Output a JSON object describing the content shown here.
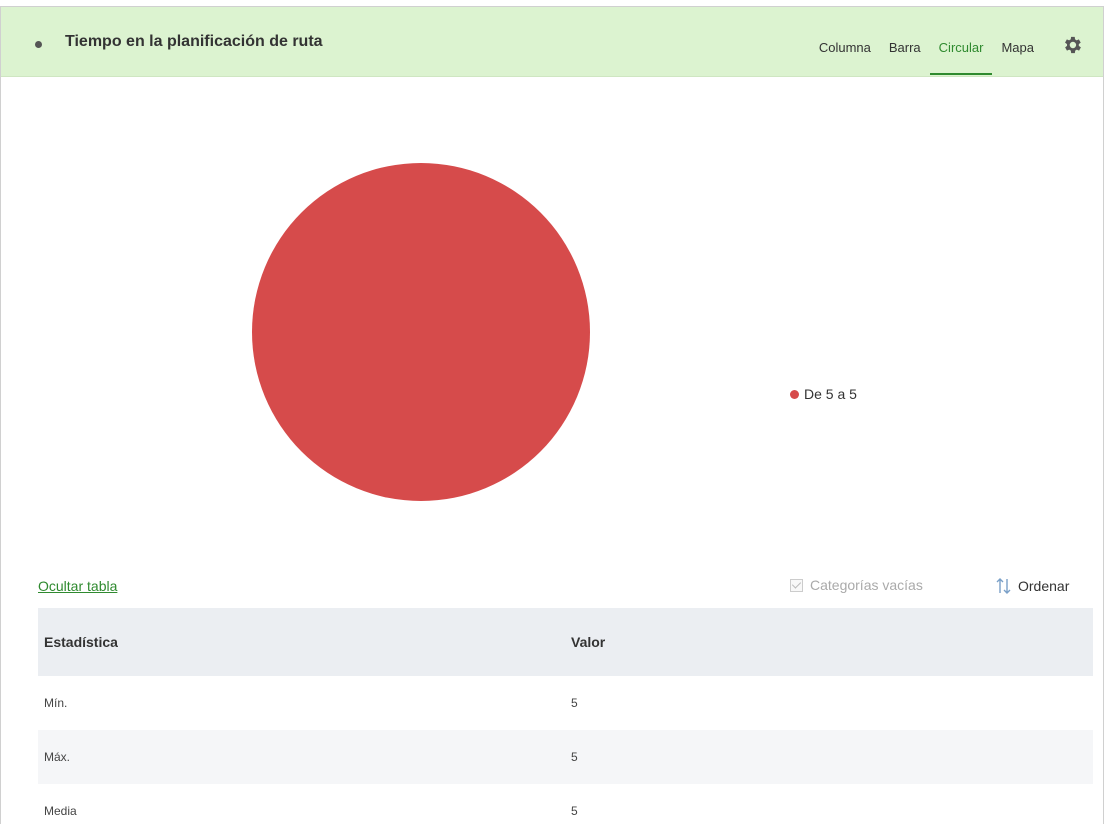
{
  "header": {
    "title": "Tiempo en la planificación de ruta",
    "tabs": [
      {
        "label": "Columna",
        "active": false
      },
      {
        "label": "Barra",
        "active": false
      },
      {
        "label": "Circular",
        "active": true
      },
      {
        "label": "Mapa",
        "active": false
      }
    ],
    "settings_icon": "gear-icon"
  },
  "colors": {
    "header_bg": "#dcf3d0",
    "accent": "#2f8a2f",
    "slice": "#d64b4b"
  },
  "chart_data": {
    "type": "pie",
    "categories": [
      "De 5 a 5"
    ],
    "values": [
      1
    ],
    "colors": [
      "#d64b4b"
    ],
    "legend_position": "right"
  },
  "toolbar": {
    "hide_table_label": "Ocultar tabla",
    "empty_categories_label": "Categorías vacías",
    "empty_categories_checked": true,
    "sort_label": "Ordenar",
    "sort_icon": "sort-arrows-icon"
  },
  "table": {
    "headers": [
      "Estadística",
      "Valor"
    ],
    "rows": [
      [
        "Mín.",
        "5"
      ],
      [
        "Máx.",
        "5"
      ],
      [
        "Media",
        "5"
      ]
    ]
  }
}
